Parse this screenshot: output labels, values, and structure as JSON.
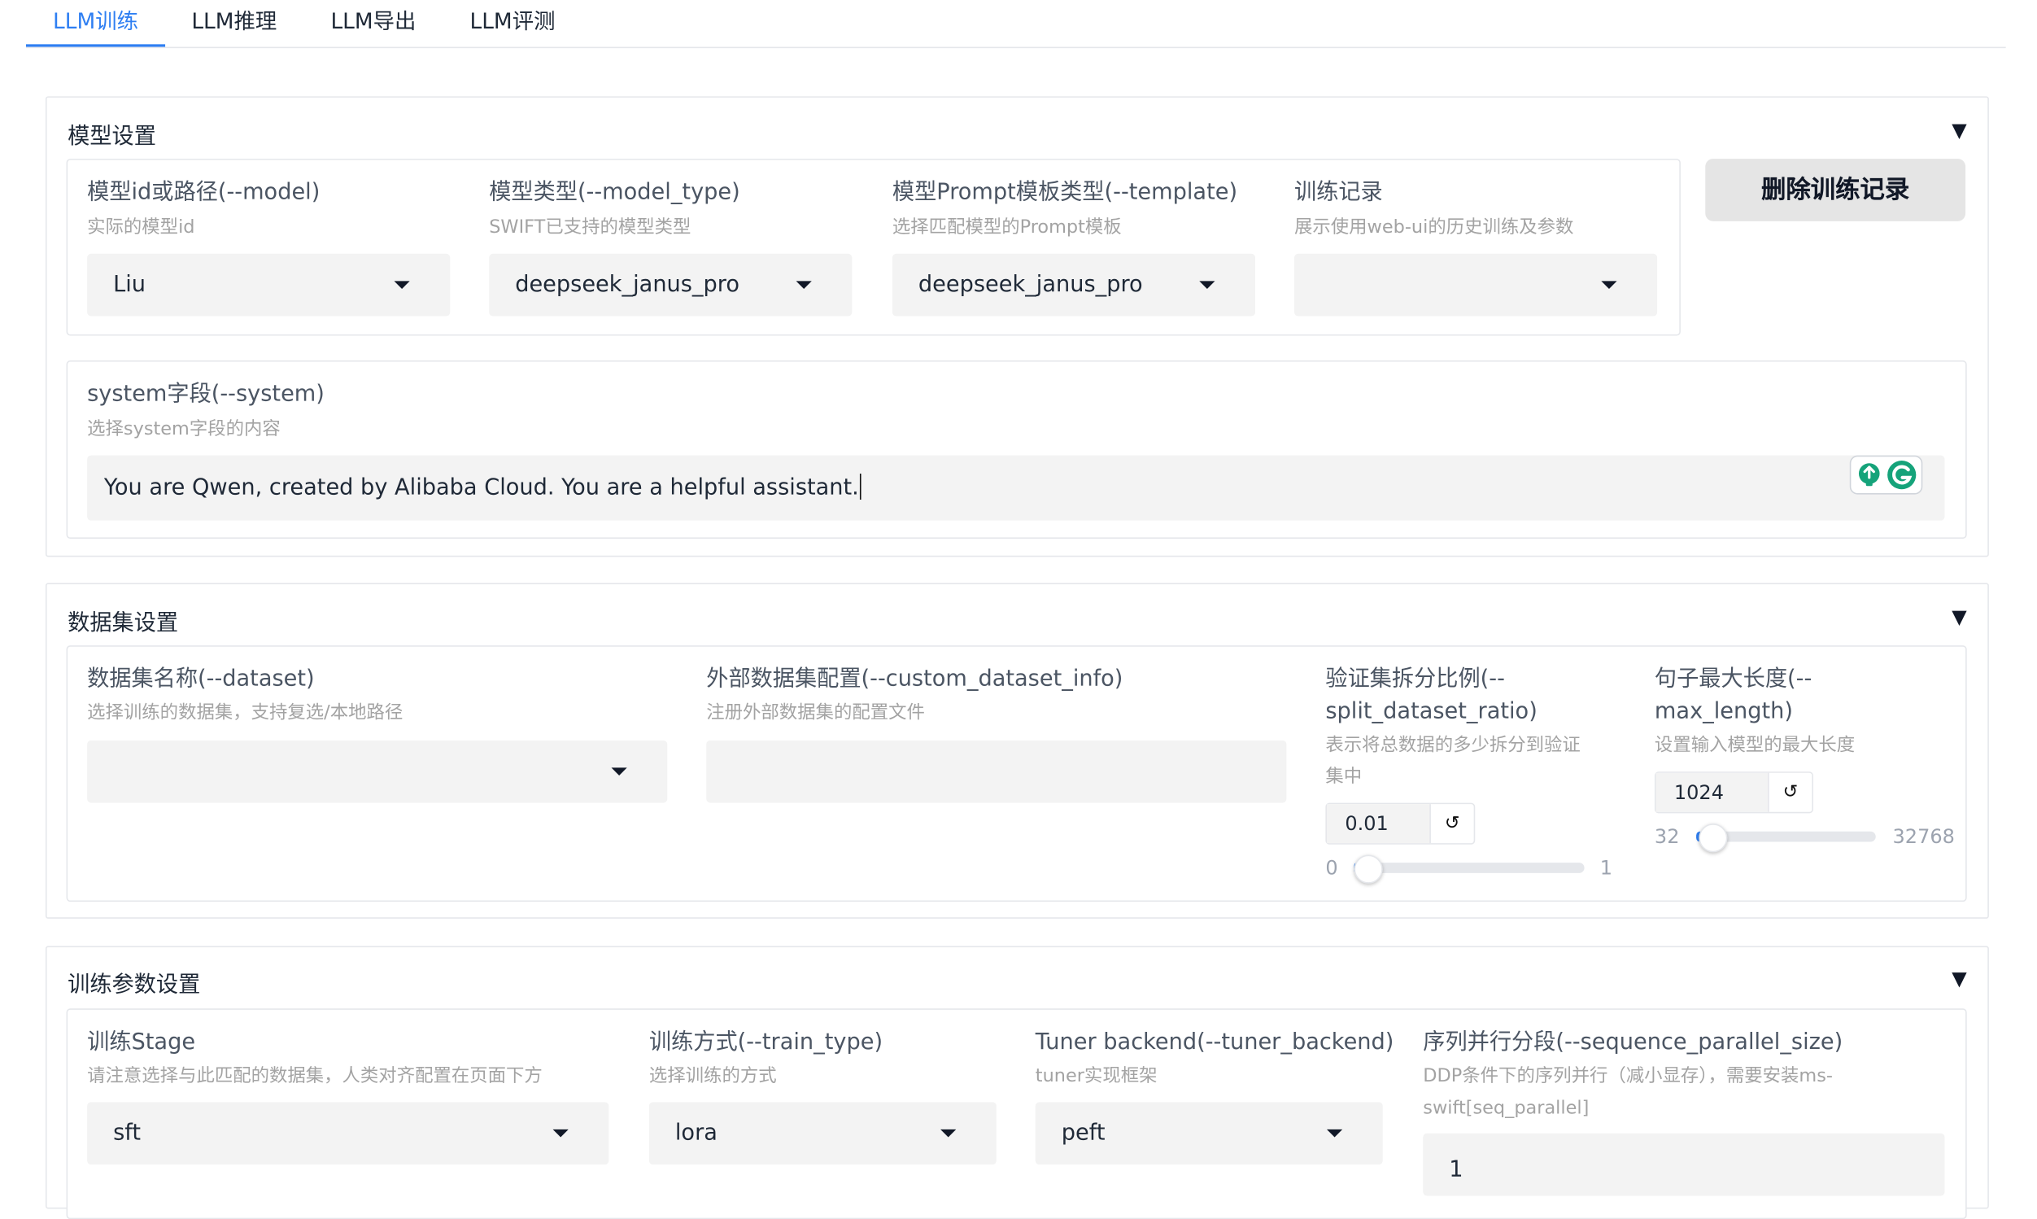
{
  "tabs": [
    {
      "label": "LLM训练",
      "active": true
    },
    {
      "label": "LLM推理",
      "active": false
    },
    {
      "label": "LLM导出",
      "active": false
    },
    {
      "label": "LLM评测",
      "active": false
    }
  ],
  "accent_color": "#2f7ff2",
  "collapse_icon": "triangle-down-icon",
  "model_settings": {
    "title": "模型设置",
    "model": {
      "label": "模型id或路径(--model)",
      "hint": "实际的模型id",
      "value": "Liu"
    },
    "model_type": {
      "label": "模型类型(--model_type)",
      "hint": "SWIFT已支持的模型类型",
      "value": "deepseek_janus_pro"
    },
    "template": {
      "label": "模型Prompt模板类型(--template)",
      "hint": "选择匹配模型的Prompt模板",
      "value": "deepseek_janus_pro"
    },
    "train_record": {
      "label": "训练记录",
      "hint": "展示使用web-ui的历史训练及参数",
      "value": ""
    },
    "delete_button": "删除训练记录",
    "system": {
      "label": "system字段(--system)",
      "hint": "选择system字段的内容",
      "value": "You are Qwen, created by Alibaba Cloud. You are a helpful assistant."
    }
  },
  "dataset_settings": {
    "title": "数据集设置",
    "dataset": {
      "label": "数据集名称(--dataset)",
      "hint": "选择训练的数据集，支持复选/本地路径",
      "value": ""
    },
    "custom_dataset_info": {
      "label": "外部数据集配置(--custom_dataset_info)",
      "hint": "注册外部数据集的配置文件",
      "value": ""
    },
    "split_ratio": {
      "label_line1": "验证集拆分比例(--",
      "label_line2": "split_dataset_ratio)",
      "hint_line1": "表示将总数据的多少拆分到验证",
      "hint_line2": "集中",
      "value": "0.01",
      "min": "0",
      "max": "1",
      "level": 0.01
    },
    "max_length": {
      "label_line1": "句子最大长度(--",
      "label_line2": "max_length)",
      "hint": "设置输入模型的最大长度",
      "value": "1024",
      "min": "32",
      "max": "32768",
      "level": 1024
    }
  },
  "training_params": {
    "title": "训练参数设置",
    "stage": {
      "label": "训练Stage",
      "hint": "请注意选择与此匹配的数据集，人类对齐配置在页面下方",
      "value": "sft"
    },
    "train_type": {
      "label": "训练方式(--train_type)",
      "hint": "选择训练的方式",
      "value": "lora"
    },
    "tuner_backend": {
      "label": "Tuner backend(--tuner_backend)",
      "hint": "tuner实现框架",
      "value": "peft"
    },
    "sequence_parallel": {
      "label": "序列并行分段(--sequence_parallel_size)",
      "hint_line1": "DDP条件下的序列并行（减小显存），需要安装ms-",
      "hint_line2": "swift[seq_parallel]",
      "value": "1"
    }
  }
}
